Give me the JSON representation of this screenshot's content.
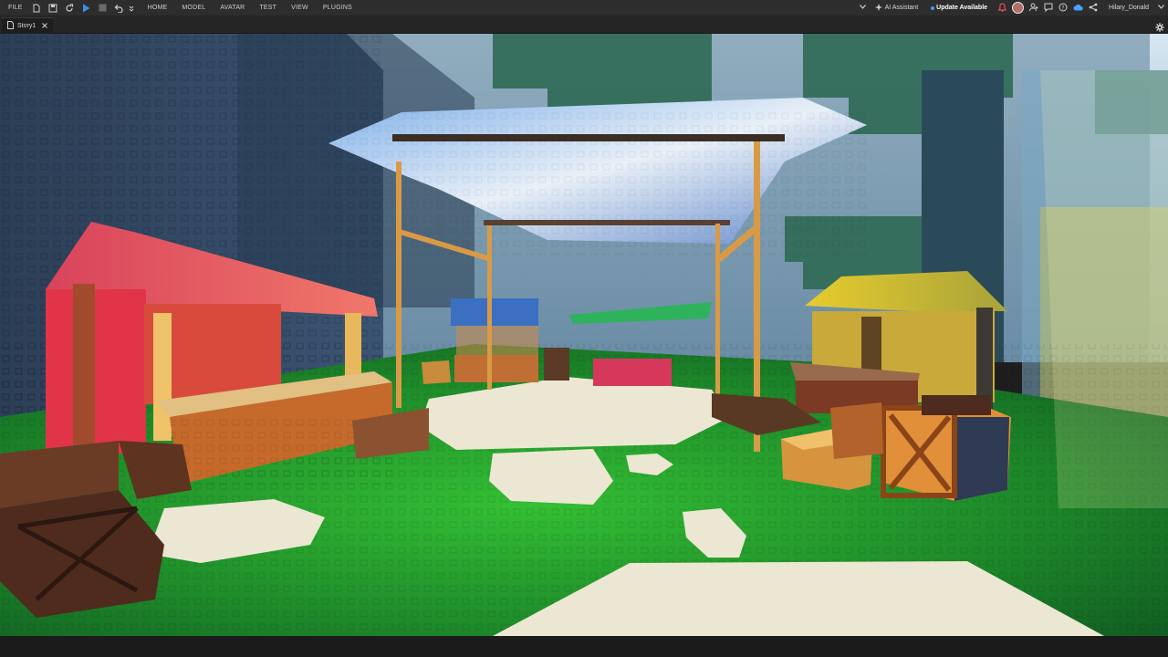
{
  "menu": {
    "file": "FILE",
    "tabs": [
      "HOME",
      "MODEL",
      "AVATAR",
      "TEST",
      "VIEW",
      "PLUGINS"
    ]
  },
  "toolbar_icons": [
    "new-file-icon",
    "save-icon",
    "refresh-icon",
    "play-icon",
    "stop-icon",
    "undo-icon",
    "undo-dropdown-icon"
  ],
  "right": {
    "ai_assistant": "AI Assistant",
    "update": "Update Available",
    "username": "Hilary_Donald"
  },
  "document_tab": {
    "label": "Story1"
  },
  "colors": {
    "update_dot": "#3a9bff",
    "play": "#3b8eea",
    "notification": "#ff5a5a"
  }
}
